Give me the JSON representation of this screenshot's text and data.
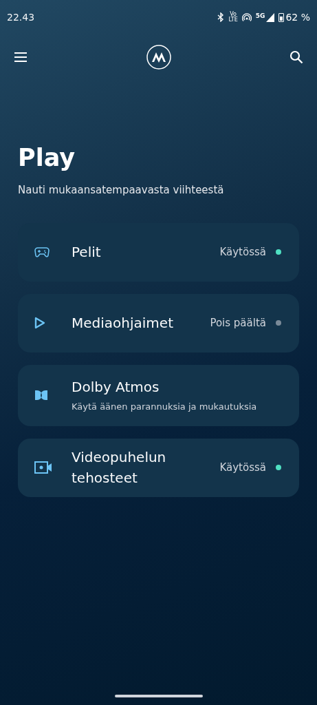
{
  "status_bar": {
    "time": "22.43",
    "volte_top": "Vo",
    "volte_bottom": "LTE",
    "network": "5G",
    "battery": "62 %"
  },
  "header": {
    "title": "Play",
    "subtitle": "Nauti mukaansatempaavasta viihteestä"
  },
  "items": [
    {
      "kind": "status",
      "title": "Pelit",
      "status": "Käytössä",
      "on": true
    },
    {
      "kind": "status",
      "title": "Mediaohjaimet",
      "status": "Pois päältä",
      "on": false
    },
    {
      "kind": "subtitle",
      "title": "Dolby Atmos",
      "subtitle": "Käytä äänen parannuksia ja mukautuksia"
    },
    {
      "kind": "status",
      "title": "Videopuhelun tehosteet",
      "status": "Käytössä",
      "on": true
    }
  ]
}
